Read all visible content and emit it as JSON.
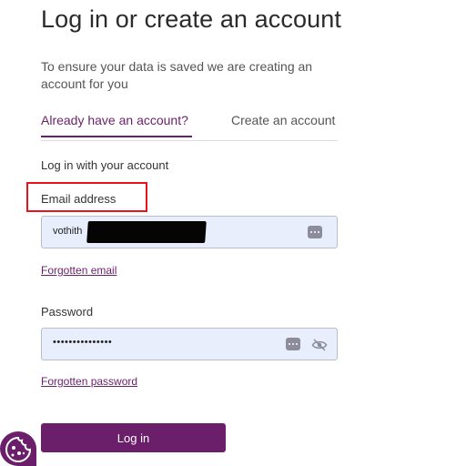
{
  "page": {
    "title": "Log in or create an account",
    "subtitle": "To ensure your data is saved we are creating an account for you"
  },
  "tabs": [
    {
      "label": "Already have an account?",
      "active": true
    },
    {
      "label": "Create an account",
      "active": false
    }
  ],
  "login_form": {
    "section_label": "Log in with your account",
    "email": {
      "label": "Email address",
      "value": "vothith"
    },
    "forgot_email_link": "Forgotten email",
    "password": {
      "label": "Password",
      "value": "•••••••••••••••"
    },
    "forgot_password_link": "Forgotten password",
    "submit_label": "Log in"
  },
  "icons": {
    "autofill": "password-manager-dots-icon",
    "visibility": "eye-slash-icon",
    "cookie": "cookie-icon"
  },
  "colors": {
    "brand": "#6b1f6b",
    "input_fill": "#e8eefc",
    "annotation_box": "#e8131b"
  }
}
